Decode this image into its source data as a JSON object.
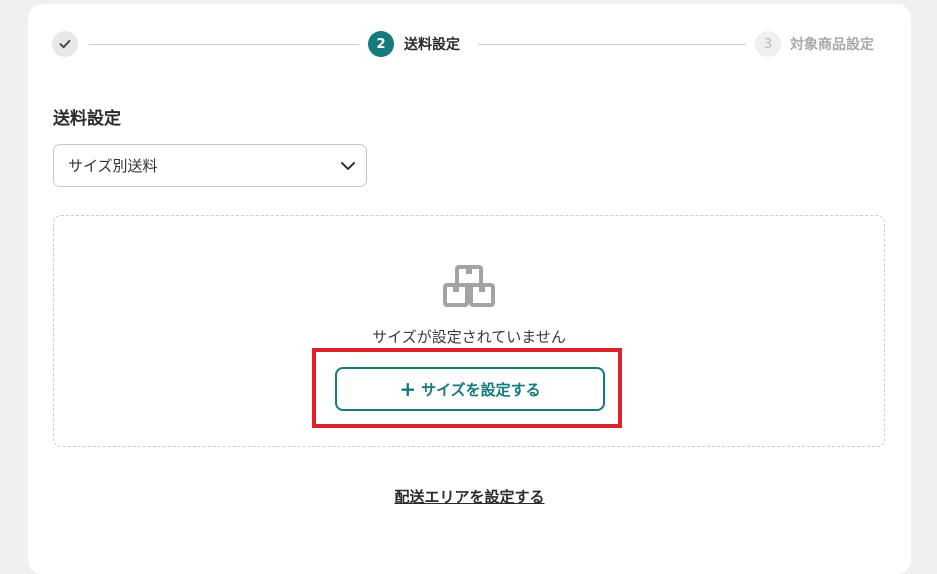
{
  "stepper": {
    "step2_number": "2",
    "step2_label": "送料設定",
    "step3_number": "3",
    "step3_label": "対象商品設定"
  },
  "section_title": "送料設定",
  "shipping_select": {
    "selected": "サイズ別送料"
  },
  "empty_state": {
    "message": "サイズが設定されていません",
    "add_button_plus": "+",
    "add_button_label": "サイズを設定する"
  },
  "area_link": "配送エリアを設定する",
  "icons": [
    "check-icon",
    "chevron-down-icon",
    "box-icon",
    "plus-icon"
  ],
  "colors": {
    "accent": "#157a7c",
    "highlight": "#e0202a"
  }
}
